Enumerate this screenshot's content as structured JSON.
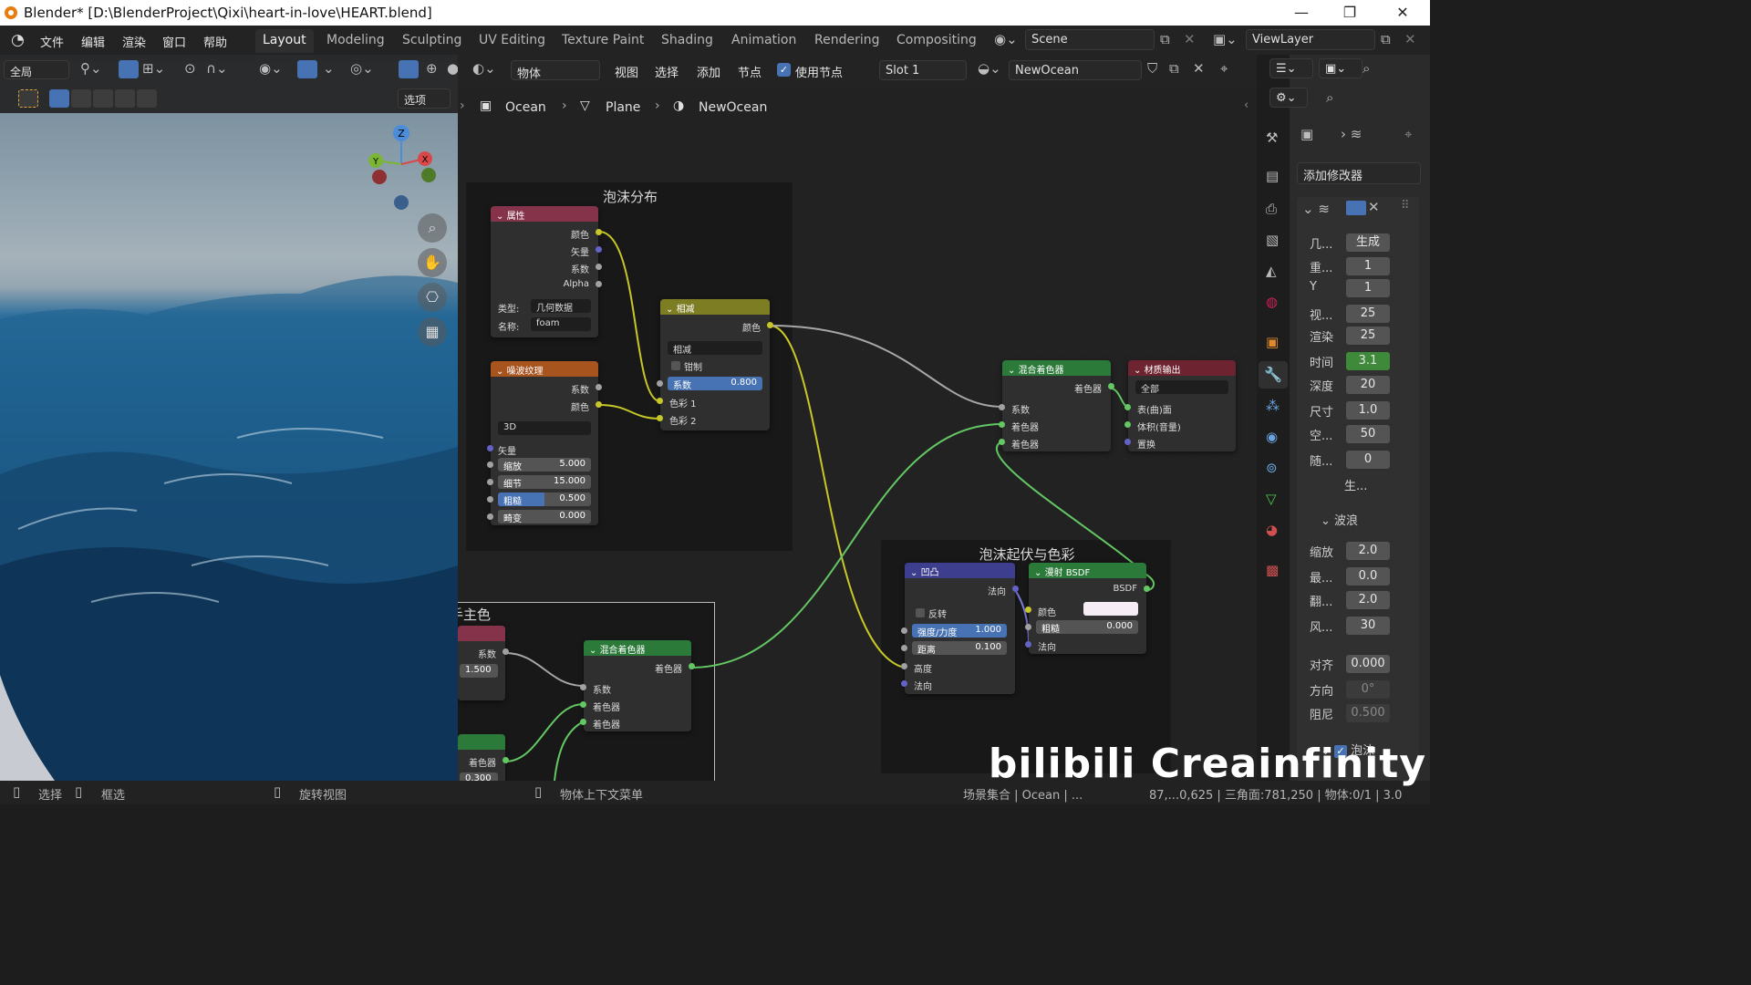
{
  "window": {
    "title": "Blender* [D:\\BlenderProject\\Qixi\\heart-in-love\\HEART.blend]",
    "min": "—",
    "max": "❐",
    "close": "✕"
  },
  "menu": [
    "文件",
    "编辑",
    "渲染",
    "窗口",
    "帮助"
  ],
  "workspaces": [
    "Layout",
    "Modeling",
    "Sculpting",
    "UV Editing",
    "Texture Paint",
    "Shading",
    "Animation",
    "Rendering",
    "Compositing"
  ],
  "scene": "Scene",
  "viewlayer": "ViewLayer",
  "viewport": {
    "orientation": "全局",
    "options": "选项",
    "axes": {
      "z": "Z",
      "y": "Y",
      "x": "X"
    }
  },
  "node_header": {
    "mode": "物体",
    "menus": [
      "视图",
      "选择",
      "添加",
      "节点"
    ],
    "use_nodes": "使用节点",
    "slot": "Slot 1",
    "material": "NewOcean"
  },
  "breadcrumb": [
    "Ocean",
    "Plane",
    "NewOcean"
  ],
  "frames": {
    "foam": "泡沫分布",
    "foam2": "泡沫起伏与色彩",
    "main": "手主色"
  },
  "nodes": {
    "attr": {
      "title": "属性",
      "outs": [
        "颜色",
        "矢量",
        "系数",
        "Alpha"
      ],
      "type_label": "类型:",
      "type_val": "几何数据",
      "name_label": "名称:",
      "name_val": "foam"
    },
    "noise": {
      "title": "噪波纹理",
      "outs": [
        "系数",
        "颜色"
      ],
      "dim": "3D",
      "vector": "矢量",
      "fields": [
        {
          "k": "缩放",
          "v": "5.000"
        },
        {
          "k": "细节",
          "v": "15.000"
        },
        {
          "k": "粗糙",
          "v": "0.500"
        },
        {
          "k": "畸变",
          "v": "0.000"
        }
      ]
    },
    "sub": {
      "title": "相减",
      "out": "颜色",
      "op": "相减",
      "clamp": "钳制",
      "fac_k": "系数",
      "fac_v": "0.800",
      "in1": "色彩 1",
      "in2": "色彩 2"
    },
    "mix1": {
      "title": "混合着色器",
      "out": "着色器",
      "ins": [
        "系数",
        "着色器",
        "着色器"
      ]
    },
    "matout": {
      "title": "材质输出",
      "target": "全部",
      "ins": [
        "表(曲)面",
        "体积(音量)",
        "置换"
      ]
    },
    "bump": {
      "title": "凹凸",
      "out": "法向",
      "invert": "反转",
      "str_k": "强度/力度",
      "str_v": "1.000",
      "dist_k": "距离",
      "dist_v": "0.100",
      "ins": [
        "高度",
        "法向"
      ]
    },
    "diffuse": {
      "title": "漫射 BSDF",
      "out": "BSDF",
      "color": "颜色",
      "rough_k": "粗糙",
      "rough_v": "0.000",
      "normal": "法向"
    },
    "mix2": {
      "title": "混合着色器",
      "out": "着色器",
      "ins": [
        "系数",
        "着色器",
        "着色器"
      ]
    },
    "left1": {
      "out": "系数",
      "val": "1.500"
    },
    "left2": {
      "out": "着色器",
      "val": "0.300"
    }
  },
  "props": {
    "add_modifier": "添加修改器",
    "rows": [
      {
        "k": "几...",
        "v": "生成"
      },
      {
        "k": "重...",
        "v": "1"
      },
      {
        "k": "Y",
        "v": "1"
      },
      {
        "k": "视...",
        "v": "25"
      },
      {
        "k": "渲染",
        "v": "25"
      },
      {
        "k": "时间",
        "v": "3.1"
      },
      {
        "k": "深度",
        "v": "20"
      },
      {
        "k": "尺寸",
        "v": "1.0"
      },
      {
        "k": "空...",
        "v": "50"
      },
      {
        "k": "随...",
        "v": "0"
      }
    ],
    "gen": "生...",
    "waves": "波浪",
    "waves_rows": [
      {
        "k": "缩放",
        "v": "2.0"
      },
      {
        "k": "最...",
        "v": "0.0"
      },
      {
        "k": "翻...",
        "v": "2.0"
      },
      {
        "k": "风...",
        "v": "30"
      }
    ],
    "align": [
      {
        "k": "对齐",
        "v": "0.000"
      },
      {
        "k": "方向",
        "v": "0°"
      },
      {
        "k": "阻尼",
        "v": "0.500"
      }
    ],
    "foam": "泡沫"
  },
  "status": {
    "select": "选择",
    "box": "框选",
    "rotate": "旋转视图",
    "context": "物体上下文菜单",
    "stats": "场景集合 | Ocean | ...",
    "stats2": "87,...0,625 | 三角面:781,250 | 物体:0/1 | 3.0"
  },
  "watermark": "bilibili Creainfinity"
}
